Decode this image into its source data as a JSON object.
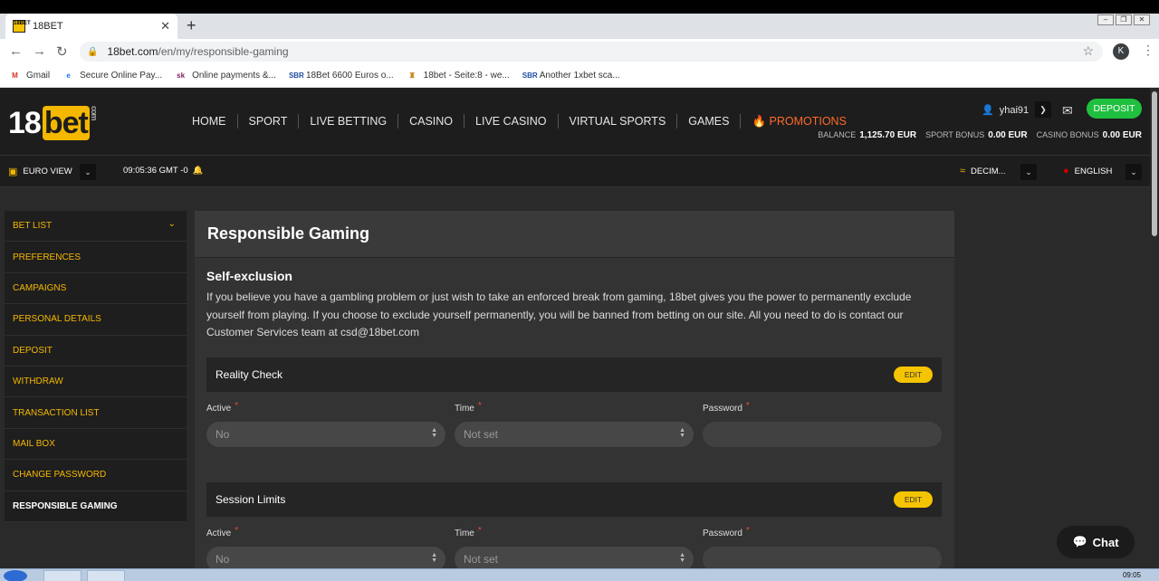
{
  "browser": {
    "tab_title": "18BET",
    "tab_favicon": "18BET",
    "url_domain": "18bet.com",
    "url_path": "/en/my/responsible-gaming",
    "profile_initial": "K",
    "bookmarks": [
      {
        "label": "Gmail",
        "icon": "M",
        "color": "#d93025"
      },
      {
        "label": "Secure Online Pay...",
        "icon": "e",
        "color": "#1a73e8"
      },
      {
        "label": "Online payments &...",
        "icon": "sk",
        "color": "#7b1f5a"
      },
      {
        "label": "18Bet 6600 Euros o...",
        "icon": "SBR",
        "color": "#1d4ea0"
      },
      {
        "label": "18bet - Seite:8 - we...",
        "icon": "♜",
        "color": "#c8861a"
      },
      {
        "label": "Another 1xbet sca...",
        "icon": "SBR",
        "color": "#1d4ea0"
      }
    ]
  },
  "header": {
    "logo_num": "18",
    "logo_bet": "bet",
    "logo_com": "com",
    "nav": [
      "HOME",
      "SPORT",
      "LIVE BETTING",
      "CASINO",
      "LIVE CASINO",
      "VIRTUAL SPORTS",
      "GAMES"
    ],
    "promo_label": "PROMOTIONS",
    "username": "yhai91",
    "deposit_label": "DEPOSIT",
    "balance_label": "BALANCE",
    "balance_value": "1,125.70 EUR",
    "sport_bonus_label": "SPORT BONUS",
    "sport_bonus_value": "0.00 EUR",
    "casino_bonus_label": "CASINO BONUS",
    "casino_bonus_value": "0.00 EUR"
  },
  "subbar": {
    "view_label": "EURO VIEW",
    "clock": "09:05:36 GMT -0",
    "odds_label": "DECIM...",
    "language": "ENGLISH"
  },
  "sidebar": {
    "items": [
      "BET LIST",
      "PREFERENCES",
      "CAMPAIGNS",
      "PERSONAL DETAILS",
      "DEPOSIT",
      "WITHDRAW",
      "TRANSACTION LIST",
      "MAIL BOX",
      "CHANGE PASSWORD",
      "RESPONSIBLE GAMING"
    ]
  },
  "main": {
    "title": "Responsible Gaming",
    "self_exclusion_title": "Self-exclusion",
    "self_exclusion_text": "If you believe you have a gambling problem or just wish to take an enforced break from gaming, 18bet gives you the power to permanently exclude yourself from playing. If you choose to exclude yourself permanently, you will be banned from betting on our site. All you need to do is contact our Customer Services team at csd@18bet.com",
    "edit_label": "EDIT",
    "reality_check": {
      "title": "Reality Check",
      "active_label": "Active",
      "active_value": "No",
      "time_label": "Time",
      "time_value": "Not set",
      "password_label": "Password"
    },
    "session_limits": {
      "title": "Session Limits",
      "active_label": "Active",
      "active_value": "No",
      "time_label": "Time",
      "time_value": "Not set",
      "password_label": "Password"
    }
  },
  "chat_label": "Chat",
  "taskbar_clock": "09:05"
}
